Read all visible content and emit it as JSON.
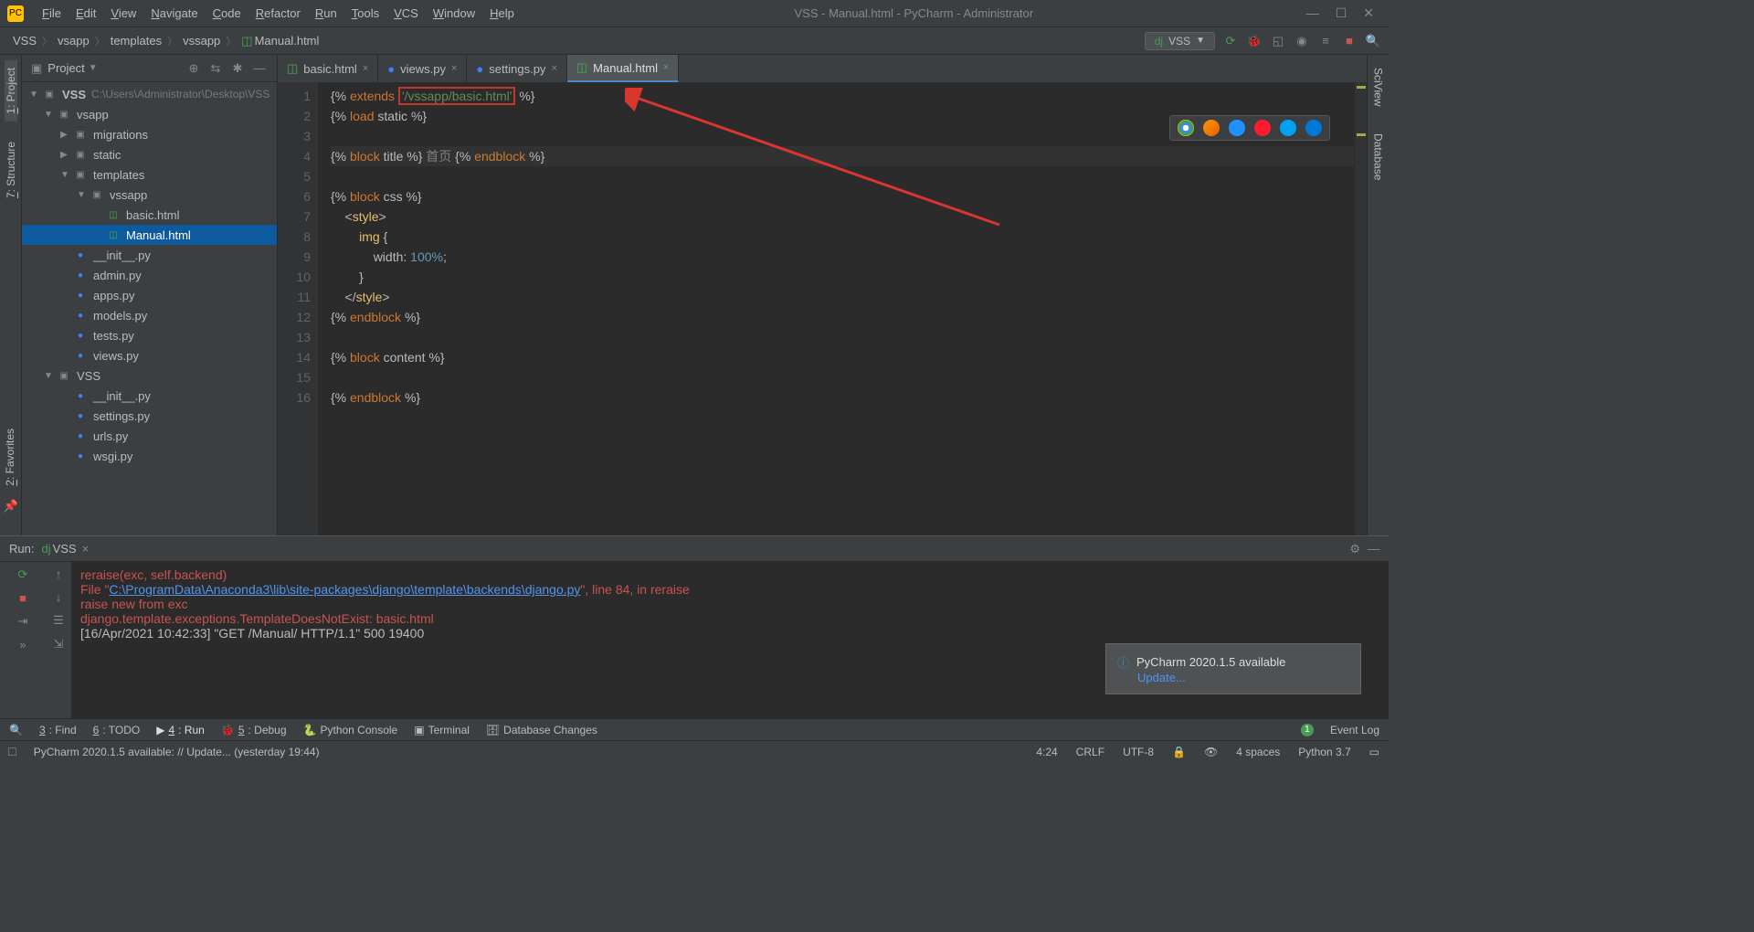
{
  "window": {
    "title": "VSS - Manual.html - PyCharm - Administrator"
  },
  "menu": [
    "File",
    "Edit",
    "View",
    "Navigate",
    "Code",
    "Refactor",
    "Run",
    "Tools",
    "VCS",
    "Window",
    "Help"
  ],
  "breadcrumb": [
    "VSS",
    "vsapp",
    "templates",
    "vssapp",
    "Manual.html"
  ],
  "run_config": "VSS",
  "project_panel": {
    "title": "Project",
    "root": "VSS",
    "root_path": "C:\\Users\\Administrator\\Desktop\\VSS",
    "items": [
      {
        "indent": 1,
        "arrow": "v",
        "icon": "folder",
        "label": "vsapp"
      },
      {
        "indent": 2,
        "arrow": ">",
        "icon": "folder",
        "label": "migrations"
      },
      {
        "indent": 2,
        "arrow": ">",
        "icon": "folder",
        "label": "static"
      },
      {
        "indent": 2,
        "arrow": "v",
        "icon": "folder",
        "label": "templates"
      },
      {
        "indent": 3,
        "arrow": "v",
        "icon": "folder",
        "label": "vssapp"
      },
      {
        "indent": 4,
        "arrow": "",
        "icon": "html",
        "label": "basic.html"
      },
      {
        "indent": 4,
        "arrow": "",
        "icon": "html",
        "label": "Manual.html",
        "selected": true
      },
      {
        "indent": 2,
        "arrow": "",
        "icon": "py",
        "label": "__init__.py"
      },
      {
        "indent": 2,
        "arrow": "",
        "icon": "py",
        "label": "admin.py"
      },
      {
        "indent": 2,
        "arrow": "",
        "icon": "py",
        "label": "apps.py"
      },
      {
        "indent": 2,
        "arrow": "",
        "icon": "py",
        "label": "models.py"
      },
      {
        "indent": 2,
        "arrow": "",
        "icon": "py",
        "label": "tests.py"
      },
      {
        "indent": 2,
        "arrow": "",
        "icon": "py",
        "label": "views.py"
      },
      {
        "indent": 1,
        "arrow": "v",
        "icon": "folder",
        "label": "VSS"
      },
      {
        "indent": 2,
        "arrow": "",
        "icon": "py",
        "label": "__init__.py"
      },
      {
        "indent": 2,
        "arrow": "",
        "icon": "py",
        "label": "settings.py"
      },
      {
        "indent": 2,
        "arrow": "",
        "icon": "py",
        "label": "urls.py"
      },
      {
        "indent": 2,
        "arrow": "",
        "icon": "py",
        "label": "wsgi.py"
      }
    ]
  },
  "tabs": [
    {
      "icon": "html",
      "label": "basic.html",
      "active": false
    },
    {
      "icon": "py",
      "label": "views.py",
      "active": false
    },
    {
      "icon": "py",
      "label": "settings.py",
      "active": false
    },
    {
      "icon": "html",
      "label": "Manual.html",
      "active": true
    }
  ],
  "code": {
    "highlight_text": "'/vssapp/basic.html'",
    "lines": [
      {
        "n": 1,
        "html": "{% <span class='kw'>extends</span> <span class='highlight-box str' data-bind='code.highlight_text'></span> %}"
      },
      {
        "n": 2,
        "html": "{% <span class='kw'>load</span> static %}"
      },
      {
        "n": 3,
        "html": ""
      },
      {
        "n": 4,
        "html": "{% <span class='kw'>block</span> title %} <span class='cmt'>首页</span> {% <span class='kw'>endblock</span> %}",
        "current": true
      },
      {
        "n": 5,
        "html": ""
      },
      {
        "n": 6,
        "html": "{% <span class='kw'>block</span> css %}"
      },
      {
        "n": 7,
        "html": "    &lt;<span class='tag'>style</span>&gt;"
      },
      {
        "n": 8,
        "html": "        <span class='tag'>img</span> {"
      },
      {
        "n": 9,
        "html": "            <span class='attr'>width</span>: <span class='num'>100%</span>;"
      },
      {
        "n": 10,
        "html": "        }"
      },
      {
        "n": 11,
        "html": "    &lt;/<span class='tag'>style</span>&gt;"
      },
      {
        "n": 12,
        "html": "{% <span class='kw'>endblock</span> %}"
      },
      {
        "n": 13,
        "html": ""
      },
      {
        "n": 14,
        "html": "{% <span class='kw'>block</span> content %}"
      },
      {
        "n": 15,
        "html": ""
      },
      {
        "n": 16,
        "html": "{% <span class='kw'>endblock</span> %}"
      }
    ]
  },
  "run_panel": {
    "title": "Run:",
    "config": "VSS",
    "lines": [
      {
        "cls": "err",
        "pre": "    ",
        "text": "reraise(exc, self.backend)"
      },
      {
        "cls": "err",
        "pre": "  File \"",
        "link": "C:\\ProgramData\\Anaconda3\\lib\\site-packages\\django\\template\\backends\\django.py",
        "post": "\", line 84, in reraise"
      },
      {
        "cls": "err",
        "pre": "    ",
        "text": "raise new from exc"
      },
      {
        "cls": "err",
        "text": "django.template.exceptions.TemplateDoesNotExist: basic.html"
      },
      {
        "cls": "log",
        "text": "[16/Apr/2021 10:42:33] \"GET /Manual/ HTTP/1.1\" 500 19400"
      }
    ]
  },
  "notification": {
    "title": "PyCharm 2020.1.5 available",
    "action": "Update..."
  },
  "bottom_tools": [
    {
      "key": "find",
      "label": "3: Find"
    },
    {
      "key": "todo",
      "label": "6: TODO"
    },
    {
      "key": "run",
      "label": "4: Run",
      "active": true,
      "icon": "play"
    },
    {
      "key": "debug",
      "label": "5: Debug",
      "icon": "bug"
    },
    {
      "key": "pyconsole",
      "label": "Python Console",
      "icon": "py"
    },
    {
      "key": "terminal",
      "label": "Terminal",
      "icon": "term"
    },
    {
      "key": "dbchanges",
      "label": "Database Changes",
      "icon": "db"
    }
  ],
  "event_log": "Event Log",
  "status": {
    "msg": "PyCharm 2020.1.5 available: // Update... (yesterday 19:44)",
    "pos": "4:24",
    "sep": "CRLF",
    "enc": "UTF-8",
    "indent": "4 spaces",
    "python": "Python 3.7"
  },
  "side_tools_left": [
    "1: Project",
    "7: Structure",
    "2: Favorites"
  ],
  "side_tools_right": [
    "SciView",
    "Database"
  ]
}
